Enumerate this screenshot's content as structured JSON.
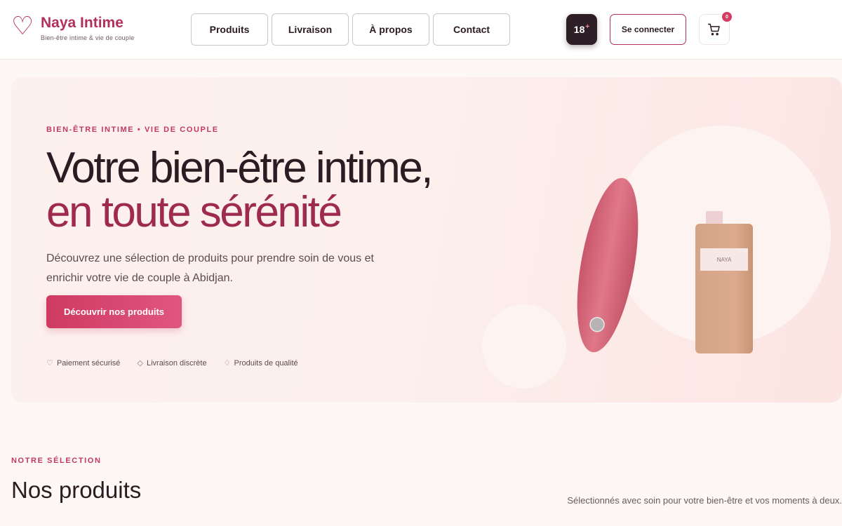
{
  "brand": {
    "name": "Naya Intime",
    "tagline": "Bien-être intime & vie de couple",
    "logo_icon": "heart-outline-icon",
    "accent_color": "#b3305a"
  },
  "nav": {
    "items": [
      {
        "label": "Produits"
      },
      {
        "label": "Livraison"
      },
      {
        "label": "À propos"
      },
      {
        "label": "Contact"
      }
    ]
  },
  "header_actions": {
    "age_badge": "18",
    "age_badge_plus": "+",
    "login_label": "Se connecter",
    "cart_count": "0",
    "cart_icon": "cart-icon"
  },
  "hero": {
    "eyebrow": "BIEN-ÊTRE INTIME • VIE DE COUPLE",
    "title_line1": "Votre bien-être intime,",
    "title_line2": "en toute sérénité",
    "description": "Découvrez une sélection de produits pour prendre soin de vous et enrichir votre vie de couple à Abidjan.",
    "cta_label": "Découvrir nos produits",
    "badges": [
      {
        "icon": "♡",
        "label": "Paiement sécurisé"
      },
      {
        "icon": "◇",
        "label": "Livraison discrète"
      },
      {
        "icon": "♢",
        "label": "Produits de qualité"
      }
    ],
    "bottle_label": "NAYA"
  },
  "products_section": {
    "eyebrow": "NOTRE SÉLECTION",
    "title": "Nos produits",
    "description": "Sélectionnés avec soin pour votre bien-être et vos moments à deux."
  }
}
